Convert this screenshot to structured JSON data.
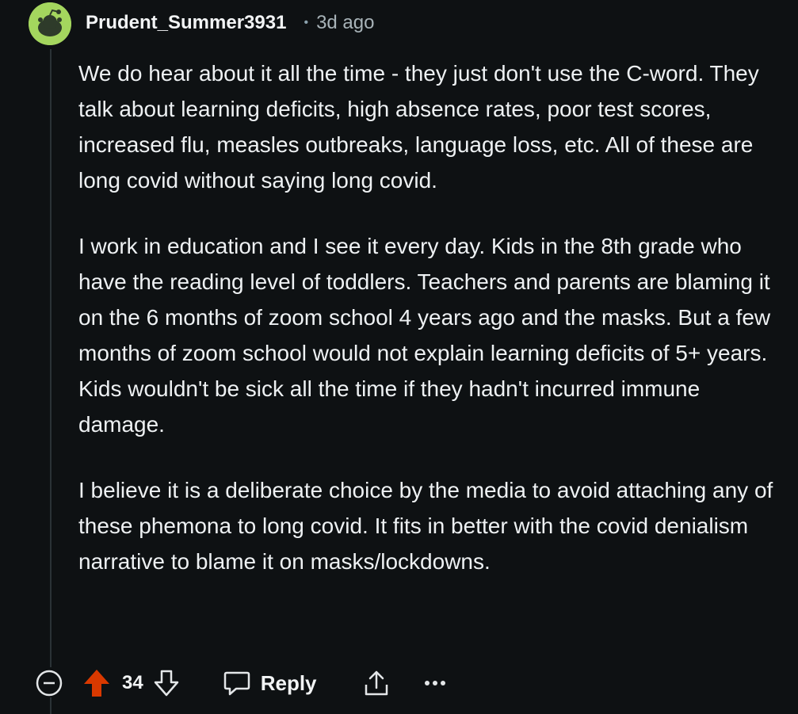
{
  "comment": {
    "author": "Prudent_Summer3931",
    "separator": "•",
    "time": "3d ago",
    "paragraphs": [
      "We do hear about it all the time - they just don't use the C-word. They talk about learning deficits, high absence rates, poor test scores, increased flu, measles outbreaks, language loss, etc. All of these are long covid without saying long covid.",
      "I work in education and I see it every day. Kids in the 8th grade who have the reading level of toddlers. Teachers and parents are blaming it on the 6 months of zoom school 4 years ago and the masks. But a few months of zoom school would not explain learning deficits of 5+ years. Kids wouldn't be sick all the time if they hadn't incurred immune damage.",
      "I believe it is a deliberate choice by the media to avoid attaching any of these phemona to long covid. It fits in better with the covid denialism narrative to blame it on masks/lockdowns."
    ]
  },
  "actions": {
    "vote_count": "34",
    "upvoted": true,
    "reply_label": "Reply"
  },
  "colors": {
    "background": "#0e1113",
    "upvote_active": "#d93900",
    "avatar": "#a4d65e"
  },
  "icons": [
    "collapse-icon",
    "upvote-icon",
    "downvote-icon",
    "reply-icon",
    "share-icon",
    "more-icon"
  ]
}
